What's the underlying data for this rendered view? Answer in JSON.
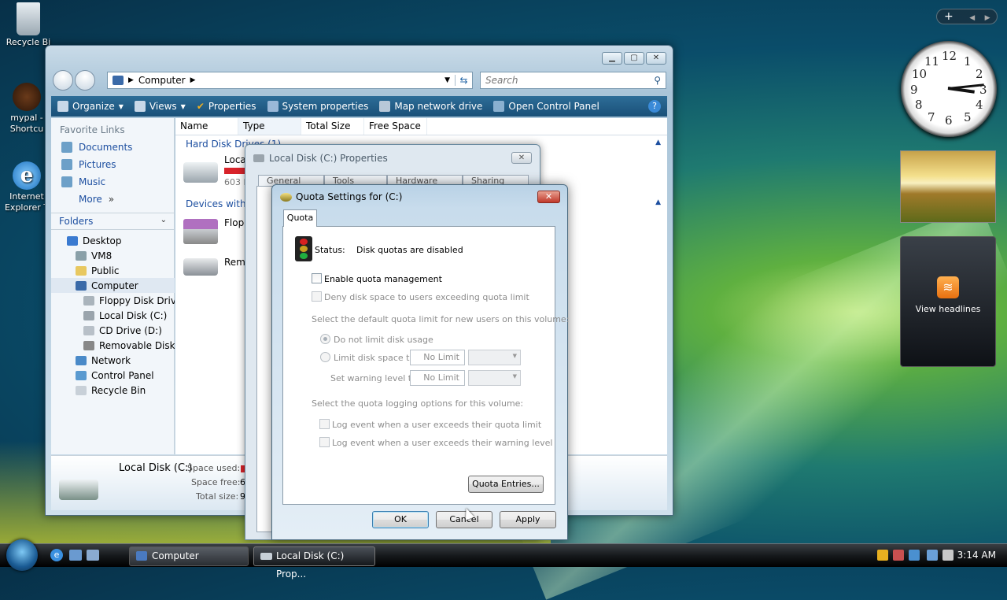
{
  "desktop": {
    "icons": [
      {
        "label": "Recycle Bi"
      },
      {
        "label": "mypal - Shortcu"
      },
      {
        "label": "Internet Explorer T"
      }
    ]
  },
  "explorer": {
    "address": "Computer",
    "search_placeholder": "Search",
    "toolbar": {
      "organize": "Organize",
      "views": "Views",
      "properties": "Properties",
      "system_properties": "System properties",
      "map_network_drive": "Map network drive",
      "open_control_panel": "Open Control Panel"
    },
    "favorites": {
      "title": "Favorite Links",
      "items": [
        "Documents",
        "Pictures",
        "Music",
        "More"
      ]
    },
    "folders_label": "Folders",
    "tree": [
      "Desktop",
      "VM8",
      "Public",
      "Computer",
      "Floppy Disk Drive",
      "Local Disk (C:)",
      "CD Drive (D:)",
      "Removable Disk (E",
      "Network",
      "Control Panel",
      "Recycle Bin"
    ],
    "columns": [
      "Name",
      "Type",
      "Total Size",
      "Free Space"
    ],
    "groups": {
      "hard_disk": "Hard Disk Drives (1)",
      "removable": "Devices with R"
    },
    "items": {
      "local": "Loca",
      "local_sub": "603 M",
      "floppy": "Flopp",
      "removable": "Remo"
    },
    "details": {
      "name": "Local Disk (C:)",
      "space_used_label": "Space used:",
      "space_free_label": "Space free:",
      "space_free_value": "60.",
      "total_size_label": "Total size:",
      "total_size_value": "9.9"
    }
  },
  "properties_dialog": {
    "title": "Local Disk (C:) Properties",
    "tabs": [
      "General",
      "Tools",
      "Hardware",
      "Sharing"
    ]
  },
  "quota_dialog": {
    "title": "Quota Settings for  (C:)",
    "tab": "Quota",
    "status_label": "Status:",
    "status_value": "Disk quotas are disabled",
    "enable_quota": "Enable quota management",
    "deny_space": "Deny disk space to users exceeding quota limit",
    "default_limit_label": "Select the default quota limit for new users on this volume:",
    "no_limit_radio": "Do not limit disk usage",
    "limit_radio": "Limit disk space to",
    "limit_value": "No Limit",
    "warning_label": "Set warning level to",
    "warning_value": "No Limit",
    "logging_label": "Select the quota logging options for this volume:",
    "log_quota": "Log event when a user exceeds their quota limit",
    "log_warning": "Log event when a user exceeds their warning level",
    "quota_entries": "Quota Entries...",
    "ok": "OK",
    "cancel": "Cancel",
    "apply": "Apply"
  },
  "taskbar": {
    "tasks": [
      "Computer",
      "Local Disk (C:) Prop..."
    ],
    "clock": "3:14 AM"
  },
  "gadgets": {
    "bar_label": "+",
    "clock_numbers": [
      "12",
      "1",
      "2",
      "3",
      "4",
      "5",
      "6",
      "7",
      "8",
      "9",
      "10",
      "11"
    ],
    "feeds_label": "View headlines"
  }
}
